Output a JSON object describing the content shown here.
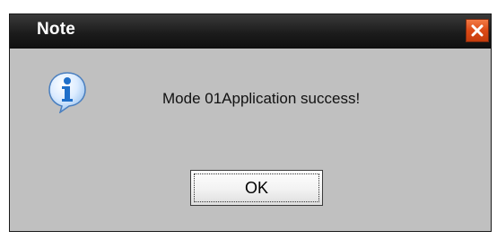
{
  "dialog": {
    "title": "Note",
    "message": "Mode 01Application success!",
    "ok_label": "OK",
    "icons": {
      "info": "info-icon",
      "close": "close-icon"
    },
    "colors": {
      "titlebar": "#1c1c1c",
      "close_button": "#dc4a16",
      "body": "#c0c0c0",
      "info_icon": "#1f6fc9"
    }
  }
}
